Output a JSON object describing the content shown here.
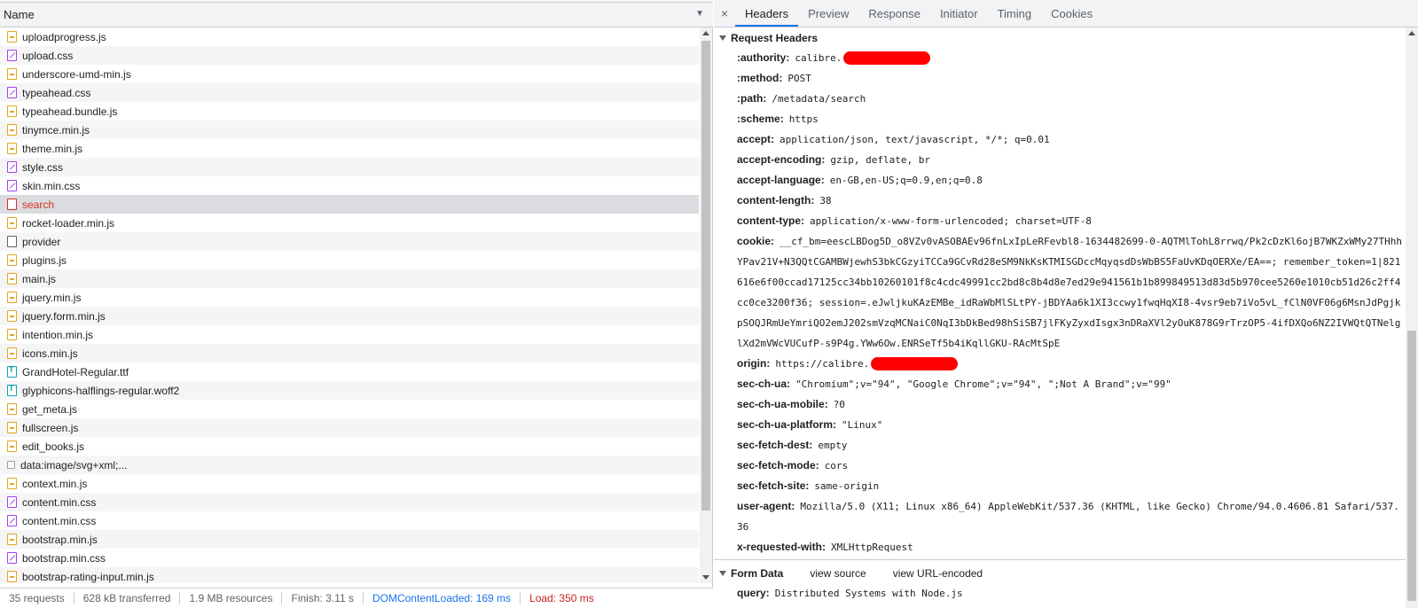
{
  "list_header": {
    "name_label": "Name"
  },
  "files": [
    {
      "name": "uploadprogress.js",
      "icon": "js-file-icon"
    },
    {
      "name": "upload.css",
      "icon": "css-file-icon"
    },
    {
      "name": "underscore-umd-min.js",
      "icon": "js-file-icon"
    },
    {
      "name": "typeahead.css",
      "icon": "css-file-icon"
    },
    {
      "name": "typeahead.bundle.js",
      "icon": "js-file-icon"
    },
    {
      "name": "tinymce.min.js",
      "icon": "js-file-icon"
    },
    {
      "name": "theme.min.js",
      "icon": "js-file-icon"
    },
    {
      "name": "style.css",
      "icon": "css-file-icon"
    },
    {
      "name": "skin.min.css",
      "icon": "css-file-icon"
    },
    {
      "name": "search",
      "icon": "xhr-file-icon",
      "selected": true
    },
    {
      "name": "rocket-loader.min.js",
      "icon": "js-file-icon"
    },
    {
      "name": "provider",
      "icon": "document-file-icon"
    },
    {
      "name": "plugins.js",
      "icon": "js-file-icon"
    },
    {
      "name": "main.js",
      "icon": "js-file-icon"
    },
    {
      "name": "jquery.min.js",
      "icon": "js-file-icon"
    },
    {
      "name": "jquery.form.min.js",
      "icon": "js-file-icon"
    },
    {
      "name": "intention.min.js",
      "icon": "js-file-icon"
    },
    {
      "name": "icons.min.js",
      "icon": "js-file-icon"
    },
    {
      "name": "GrandHotel-Regular.ttf",
      "icon": "font-file-icon"
    },
    {
      "name": "glyphicons-halflings-regular.woff2",
      "icon": "font-file-icon"
    },
    {
      "name": "get_meta.js",
      "icon": "js-file-icon"
    },
    {
      "name": "fullscreen.js",
      "icon": "js-file-icon"
    },
    {
      "name": "edit_books.js",
      "icon": "js-file-icon"
    },
    {
      "name": "data:image/svg+xml;...",
      "icon": "image-file-icon"
    },
    {
      "name": "context.min.js",
      "icon": "js-file-icon"
    },
    {
      "name": "content.min.css",
      "icon": "css-file-icon"
    },
    {
      "name": "content.min.css",
      "icon": "css-file-icon"
    },
    {
      "name": "bootstrap.min.js",
      "icon": "js-file-icon"
    },
    {
      "name": "bootstrap.min.css",
      "icon": "css-file-icon"
    },
    {
      "name": "bootstrap-rating-input.min.js",
      "icon": "js-file-icon"
    }
  ],
  "status": {
    "requests": "35 requests",
    "transferred": "628 kB transferred",
    "resources": "1.9 MB resources",
    "finish": "Finish: 3.11 s",
    "dom_content_loaded": "DOMContentLoaded: 169 ms",
    "load": "Load: 350 ms"
  },
  "tabs": {
    "close": "×",
    "items": [
      "Headers",
      "Preview",
      "Response",
      "Initiator",
      "Timing",
      "Cookies"
    ],
    "active": "Headers"
  },
  "request_headers": {
    "title": "Request Headers",
    "rows": [
      {
        "key": ":authority:",
        "value": "calibre.",
        "redacted": true
      },
      {
        "key": ":method:",
        "value": "POST"
      },
      {
        "key": ":path:",
        "value": "/metadata/search"
      },
      {
        "key": ":scheme:",
        "value": "https"
      },
      {
        "key": "accept:",
        "value": "application/json, text/javascript, */*; q=0.01"
      },
      {
        "key": "accept-encoding:",
        "value": "gzip, deflate, br"
      },
      {
        "key": "accept-language:",
        "value": "en-GB,en-US;q=0.9,en;q=0.8"
      },
      {
        "key": "content-length:",
        "value": "38"
      },
      {
        "key": "content-type:",
        "value": "application/x-www-form-urlencoded; charset=UTF-8"
      },
      {
        "key": "cookie:",
        "value": "__cf_bm=eescLBDog5D_o8VZv0vASOBAEv96fnLxIpLeRFevbl8-1634482699-0-AQTMlTohL8rrwq/Pk2cDzKl6ojB7WKZxWMy27THhhYPav21V+N3QQtCGAMBWjewhS3bkCGzyiTCCa9GCvRd28eSM9NkKsKTMISGDccMqyqsdDsWbBS5FaUvKDqOERXe/EA==; remember_token=1|821616e6f00ccad17125cc34bb10260101f8c4cdc49991cc2bd8c8b4d8e7ed29e941561b1b899849513d83d5b970cee5260e1010cb51d26c2ff4cc0ce3200f36; session=.eJwljkuKAzEMBe_idRaWbMlSLtPY-jBDYAa6k1XI3ccwy1fwqHqXI8-4vsr9eb7iVo5vL_fClN0VF06g6MsnJdPgjkpSOQJRmUeYmriQO2emJ202smVzqMCNaiC0NqI3bDkBed98hSiSB7jlFKyZyxdIsgx3nDRaXVl2yOuK878G9rTrzOP5-4ifDXQo6NZ2IVWQtQTNelglXd2mVWcVUCufP-s9P4g.YWw6Ow.ENRSeTf5b4iKqllGKU-RAcMtSpE"
      },
      {
        "key": "origin:",
        "value": "https://calibre.",
        "redacted": true
      },
      {
        "key": "sec-ch-ua:",
        "value": "\"Chromium\";v=\"94\", \"Google Chrome\";v=\"94\", \";Not A Brand\";v=\"99\""
      },
      {
        "key": "sec-ch-ua-mobile:",
        "value": "?0"
      },
      {
        "key": "sec-ch-ua-platform:",
        "value": "\"Linux\""
      },
      {
        "key": "sec-fetch-dest:",
        "value": "empty"
      },
      {
        "key": "sec-fetch-mode:",
        "value": "cors"
      },
      {
        "key": "sec-fetch-site:",
        "value": "same-origin"
      },
      {
        "key": "user-agent:",
        "value": "Mozilla/5.0 (X11; Linux x86_64) AppleWebKit/537.36 (KHTML, like Gecko) Chrome/94.0.4606.81 Safari/537.36"
      },
      {
        "key": "x-requested-with:",
        "value": "XMLHttpRequest"
      }
    ]
  },
  "form_data": {
    "title": "Form Data",
    "view_source": "view source",
    "view_url_encoded": "view URL-encoded",
    "rows": [
      {
        "key": "query:",
        "value": "Distributed Systems with Node.js"
      }
    ]
  }
}
